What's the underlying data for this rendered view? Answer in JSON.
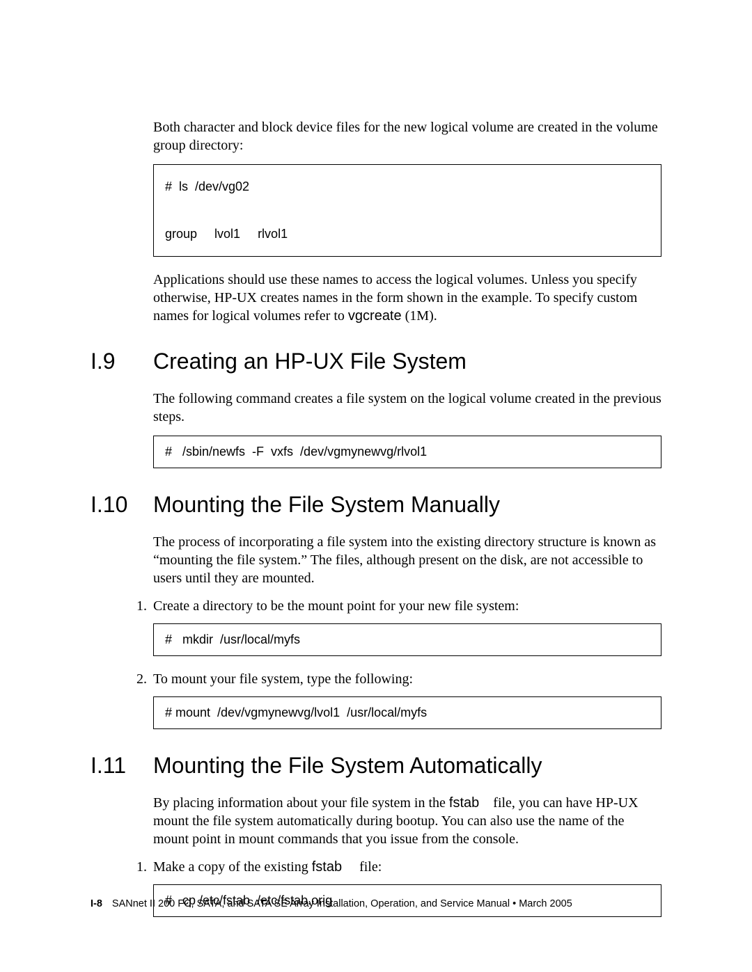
{
  "intro": {
    "para": "Both character and block device files for the new logical volume are created in the volume group directory:",
    "code": "#  ls  /dev/vg02\n\ngroup     lvol1     rlvol1",
    "para2_a": "Applications should use these names to access the logical volumes. Unless you specify otherwise, HP-UX creates names in the form shown in the example. To specify custom names for logical volumes refer to ",
    "para2_code": "vgcreate",
    "para2_b": "  (1M)."
  },
  "s9": {
    "num": "I.9",
    "title": "Creating an HP-UX File System",
    "para": "The following command creates a file system on the logical volume created in the previous steps.",
    "code": "#   /sbin/newfs  -F  vxfs  /dev/vgmynewvg/rlvol1"
  },
  "s10": {
    "num": "I.10",
    "title": "Mounting the File System Manually",
    "para": "The process of incorporating a file system into the existing directory structure is known as “mounting the file system.” The files, although present on the disk, are not accessible to users until they are mounted.",
    "step1_num": "1.",
    "step1": "Create a directory to be the mount point for your new file system:",
    "code1": "#   mkdir  /usr/local/myfs",
    "step2_num": "2.",
    "step2": "To mount your file system, type the following:",
    "code2": "# mount  /dev/vgmynewvg/lvol1  /usr/local/myfs"
  },
  "s11": {
    "num": "I.11",
    "title": "Mounting the File System Automatically",
    "para_a": "By placing information about your file system in the ",
    "para_code": "fstab",
    "para_b": " file, you can have HP-UX mount the file system automatically during bootup. You can also use the name of the mount point in mount commands that you issue from the console.",
    "step1_num": "1.",
    "step1_a": "Make a copy of the existing ",
    "step1_code": "fstab",
    "step1_b": " file:",
    "code1": "#   cp /etc/fstab  /etc/fstab.orig"
  },
  "footer": {
    "page": "I-8",
    "text": "SANnet II 200 FC, SATA, and SATA SE Array Installation, Operation, and Service Manual • March 2005"
  }
}
